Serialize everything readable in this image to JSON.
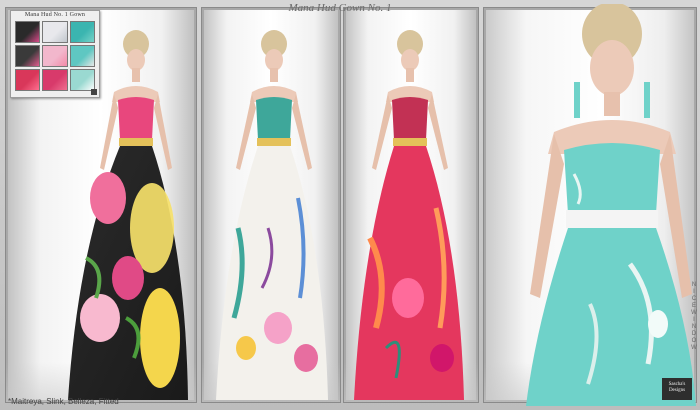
{
  "hud": {
    "title": "Mana Hud No. 1 Gown",
    "swatches": [
      {
        "color": "#2a2a2a",
        "accent": "#d94b8a"
      },
      {
        "color": "#e8e8ec",
        "accent": "#c0c6cc"
      },
      {
        "color": "#3bb5b0",
        "accent": "#78d3c9"
      },
      {
        "color": "#3a3a3a",
        "accent": "#e25c8e"
      },
      {
        "color": "#f2b7cc",
        "accent": "#f38aa8"
      },
      {
        "color": "#5fc7c2",
        "accent": "#e8e8e8"
      },
      {
        "color": "#d9375a",
        "accent": "#ff6f8f"
      },
      {
        "color": "#d83a6b",
        "accent": "#f06f90"
      },
      {
        "color": "#9ad9d1",
        "accent": "#ffffff"
      }
    ]
  },
  "heading": "Mana Hud Gown No. 1",
  "vertical_brand": "NICEWINDOW",
  "brand_box": "Sascha's Designs",
  "footnote": "*Maitreya, Slink, Belleza, Fitted",
  "palette": {
    "skin": "#eccab8",
    "hair": "#d8c49c",
    "gown1_base": "#f3a7c4",
    "gown1_accent": "#f6e16a",
    "gown2_base": "#f3f1ec",
    "gown2_accent": "#3ea79a",
    "gown3_base": "#e4375e",
    "gown3_accent": "#ff8a4c",
    "gown4_base": "#6fd2c9",
    "belt": "#e4c15a",
    "belt_white": "#f4f4f4"
  }
}
